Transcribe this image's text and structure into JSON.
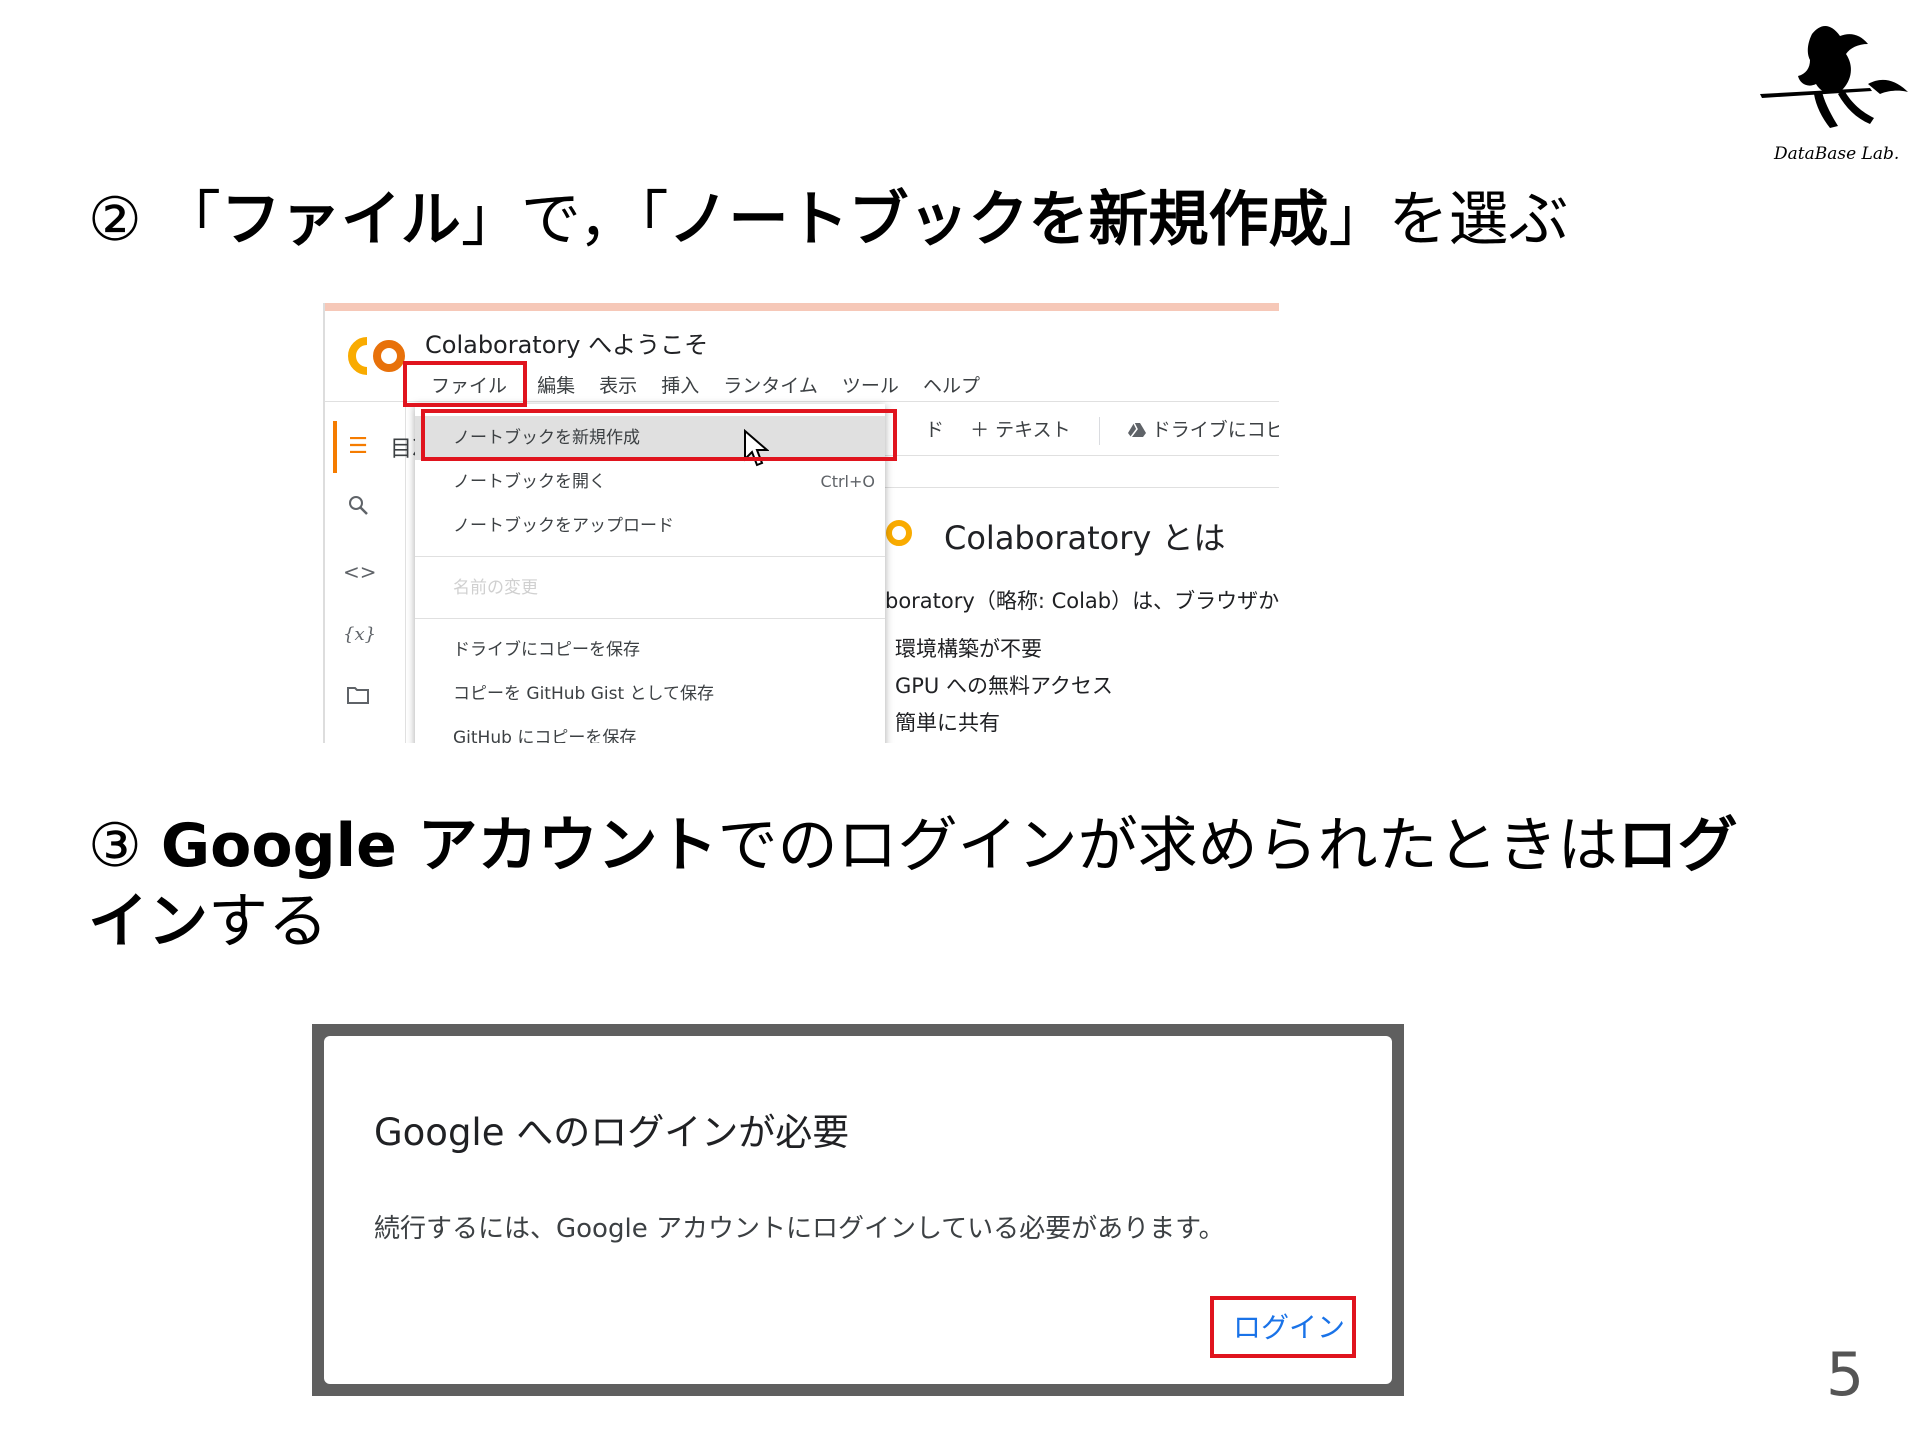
{
  "logo": {
    "text": "DataBase Lab."
  },
  "step2": {
    "num": "②",
    "open1": "「",
    "bold1": "ファイル",
    "mid": "」で，「",
    "bold2": "ノートブックを新規作成",
    "end": "」を選ぶ"
  },
  "colab": {
    "title": "Colaboratory へようこそ",
    "menu": [
      "ファイル",
      "編集",
      "表示",
      "挿入",
      "ランタイム",
      "ツール",
      "ヘルプ"
    ],
    "toc_label": "目次",
    "toolbar": {
      "text_btn": "＋ テキスト",
      "drive_btn": "ドライブにコピー",
      "code_fragment": "ド"
    },
    "file_menu": {
      "new_notebook": "ノートブックを新規作成",
      "open_notebook": "ノートブックを開く",
      "open_shortcut": "Ctrl+O",
      "upload_notebook": "ノートブックをアップロード",
      "rename": "名前の変更",
      "save_drive": "ドライブにコピーを保存",
      "save_gist": "コピーを GitHub Gist として保存",
      "save_github": "GitHub にコピーを保存"
    },
    "content": {
      "heading": "Colaboratory とは",
      "desc": "boratory（略称: Colab）は、ブラウザか",
      "bullets": [
        "環境構築が不要",
        "GPU への無料アクセス",
        "簡単に共有"
      ]
    },
    "colors": {
      "accent": "#f57c00",
      "highlight_box": "#e0141e"
    }
  },
  "step3": {
    "num": "③",
    "bold1": "Google アカウント",
    "mid": "でのログインが求められたときは",
    "bold2a": "ログ",
    "bold2b": "イン",
    "end": "する"
  },
  "login_dialog": {
    "title": "Google へのログインが必要",
    "message": "続行するには、Google アカウントにログインしている必要があります。",
    "login_button": "ログイン",
    "button_color": "#1a73e8"
  },
  "page_number": "5"
}
